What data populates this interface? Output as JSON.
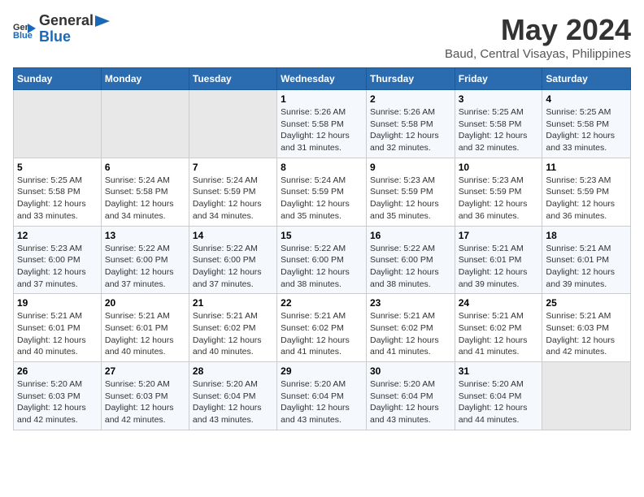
{
  "header": {
    "logo_general": "General",
    "logo_blue": "Blue",
    "title": "May 2024",
    "subtitle": "Baud, Central Visayas, Philippines"
  },
  "weekdays": [
    "Sunday",
    "Monday",
    "Tuesday",
    "Wednesday",
    "Thursday",
    "Friday",
    "Saturday"
  ],
  "weeks": [
    [
      {
        "day": "",
        "empty": true
      },
      {
        "day": "",
        "empty": true
      },
      {
        "day": "",
        "empty": true
      },
      {
        "day": "1",
        "sunrise": "5:26 AM",
        "sunset": "5:58 PM",
        "daylight": "12 hours and 31 minutes."
      },
      {
        "day": "2",
        "sunrise": "5:26 AM",
        "sunset": "5:58 PM",
        "daylight": "12 hours and 32 minutes."
      },
      {
        "day": "3",
        "sunrise": "5:25 AM",
        "sunset": "5:58 PM",
        "daylight": "12 hours and 32 minutes."
      },
      {
        "day": "4",
        "sunrise": "5:25 AM",
        "sunset": "5:58 PM",
        "daylight": "12 hours and 33 minutes."
      }
    ],
    [
      {
        "day": "5",
        "sunrise": "5:25 AM",
        "sunset": "5:58 PM",
        "daylight": "12 hours and 33 minutes."
      },
      {
        "day": "6",
        "sunrise": "5:24 AM",
        "sunset": "5:58 PM",
        "daylight": "12 hours and 34 minutes."
      },
      {
        "day": "7",
        "sunrise": "5:24 AM",
        "sunset": "5:59 PM",
        "daylight": "12 hours and 34 minutes."
      },
      {
        "day": "8",
        "sunrise": "5:24 AM",
        "sunset": "5:59 PM",
        "daylight": "12 hours and 35 minutes."
      },
      {
        "day": "9",
        "sunrise": "5:23 AM",
        "sunset": "5:59 PM",
        "daylight": "12 hours and 35 minutes."
      },
      {
        "day": "10",
        "sunrise": "5:23 AM",
        "sunset": "5:59 PM",
        "daylight": "12 hours and 36 minutes."
      },
      {
        "day": "11",
        "sunrise": "5:23 AM",
        "sunset": "5:59 PM",
        "daylight": "12 hours and 36 minutes."
      }
    ],
    [
      {
        "day": "12",
        "sunrise": "5:23 AM",
        "sunset": "6:00 PM",
        "daylight": "12 hours and 37 minutes."
      },
      {
        "day": "13",
        "sunrise": "5:22 AM",
        "sunset": "6:00 PM",
        "daylight": "12 hours and 37 minutes."
      },
      {
        "day": "14",
        "sunrise": "5:22 AM",
        "sunset": "6:00 PM",
        "daylight": "12 hours and 37 minutes."
      },
      {
        "day": "15",
        "sunrise": "5:22 AM",
        "sunset": "6:00 PM",
        "daylight": "12 hours and 38 minutes."
      },
      {
        "day": "16",
        "sunrise": "5:22 AM",
        "sunset": "6:00 PM",
        "daylight": "12 hours and 38 minutes."
      },
      {
        "day": "17",
        "sunrise": "5:21 AM",
        "sunset": "6:01 PM",
        "daylight": "12 hours and 39 minutes."
      },
      {
        "day": "18",
        "sunrise": "5:21 AM",
        "sunset": "6:01 PM",
        "daylight": "12 hours and 39 minutes."
      }
    ],
    [
      {
        "day": "19",
        "sunrise": "5:21 AM",
        "sunset": "6:01 PM",
        "daylight": "12 hours and 40 minutes."
      },
      {
        "day": "20",
        "sunrise": "5:21 AM",
        "sunset": "6:01 PM",
        "daylight": "12 hours and 40 minutes."
      },
      {
        "day": "21",
        "sunrise": "5:21 AM",
        "sunset": "6:02 PM",
        "daylight": "12 hours and 40 minutes."
      },
      {
        "day": "22",
        "sunrise": "5:21 AM",
        "sunset": "6:02 PM",
        "daylight": "12 hours and 41 minutes."
      },
      {
        "day": "23",
        "sunrise": "5:21 AM",
        "sunset": "6:02 PM",
        "daylight": "12 hours and 41 minutes."
      },
      {
        "day": "24",
        "sunrise": "5:21 AM",
        "sunset": "6:02 PM",
        "daylight": "12 hours and 41 minutes."
      },
      {
        "day": "25",
        "sunrise": "5:21 AM",
        "sunset": "6:03 PM",
        "daylight": "12 hours and 42 minutes."
      }
    ],
    [
      {
        "day": "26",
        "sunrise": "5:20 AM",
        "sunset": "6:03 PM",
        "daylight": "12 hours and 42 minutes."
      },
      {
        "day": "27",
        "sunrise": "5:20 AM",
        "sunset": "6:03 PM",
        "daylight": "12 hours and 42 minutes."
      },
      {
        "day": "28",
        "sunrise": "5:20 AM",
        "sunset": "6:04 PM",
        "daylight": "12 hours and 43 minutes."
      },
      {
        "day": "29",
        "sunrise": "5:20 AM",
        "sunset": "6:04 PM",
        "daylight": "12 hours and 43 minutes."
      },
      {
        "day": "30",
        "sunrise": "5:20 AM",
        "sunset": "6:04 PM",
        "daylight": "12 hours and 43 minutes."
      },
      {
        "day": "31",
        "sunrise": "5:20 AM",
        "sunset": "6:04 PM",
        "daylight": "12 hours and 44 minutes."
      },
      {
        "day": "",
        "empty": true
      }
    ]
  ],
  "labels": {
    "sunrise": "Sunrise:",
    "sunset": "Sunset:",
    "daylight": "Daylight:"
  },
  "colors": {
    "header_bg": "#2b6cb0",
    "odd_row": "#f5f8fc",
    "empty_cell": "#e8e8e8"
  }
}
